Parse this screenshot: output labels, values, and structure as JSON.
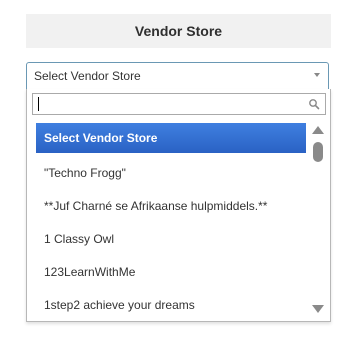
{
  "header": {
    "title": "Vendor Store"
  },
  "select": {
    "value": "Select Vendor Store",
    "arrow_icon": "chevron-down-icon"
  },
  "dropdown": {
    "search": {
      "value": "",
      "placeholder": "",
      "icon": "search-icon"
    },
    "highlighted_index": 0,
    "options": [
      {
        "label": "Select Vendor Store"
      },
      {
        "label": "\"Techno Frogg\""
      },
      {
        "label": "**Juf Charné se Afrikaanse hulpmiddels.**"
      },
      {
        "label": "1 Classy Owl"
      },
      {
        "label": "123LearnWithMe"
      },
      {
        "label": "1step2 achieve your dreams"
      }
    ],
    "scrollbar": {
      "up_icon": "scroll-up-arrow-icon",
      "down_icon": "scroll-down-arrow-icon"
    }
  },
  "colors": {
    "highlight": "#3875d7",
    "header_bg": "#f1f1f1",
    "select_border": "#6a98b4"
  }
}
